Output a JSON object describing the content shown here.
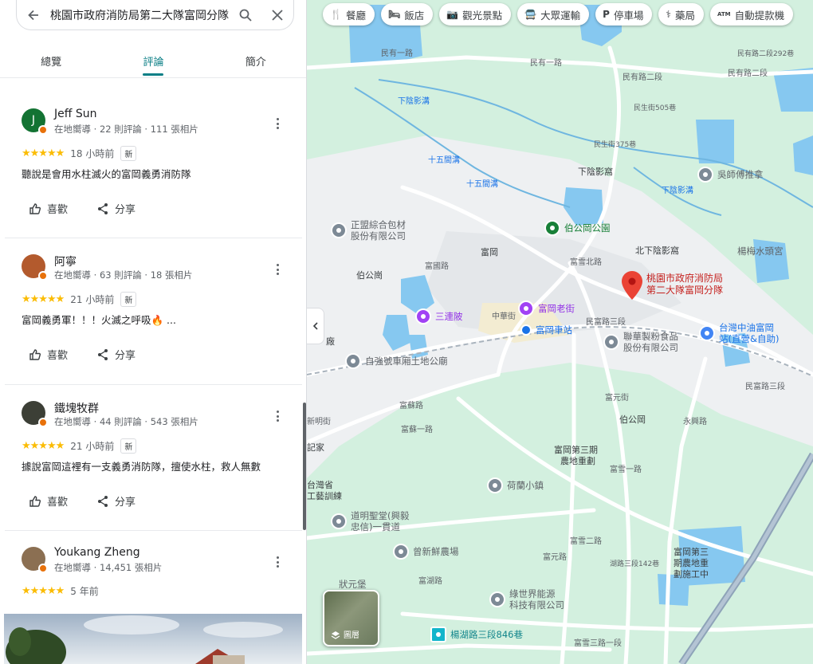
{
  "search": {
    "value": "桃園市政府消防局第二大隊富岡分隊",
    "back_icon": "arrow-left-icon",
    "search_icon": "search-icon",
    "close_icon": "close-icon"
  },
  "tabs": [
    {
      "label": "總覽",
      "active": false
    },
    {
      "label": "評論",
      "active": true
    },
    {
      "label": "簡介",
      "active": false
    }
  ],
  "reviews": [
    {
      "name": "Jeff Sun",
      "meta": "在地嚮導 · 22 則評論 · 111 張相片",
      "rating": "★★★★★",
      "time": "18 小時前",
      "badge": "新",
      "text": "聽說是會用水柱滅火的富岡義勇消防隊",
      "avatar_letter": "J",
      "avatar_color": "#137333",
      "like": "喜歡",
      "share": "分享"
    },
    {
      "name": "阿寧",
      "meta": "在地嚮導 · 63 則評論 · 18 張相片",
      "rating": "★★★★★",
      "time": "21 小時前",
      "badge": "新",
      "text": "富岡義勇軍！！！火滅之呼吸🔥 ...",
      "avatar_letter": "",
      "avatar_color": "#b35a2d",
      "like": "喜歡",
      "share": "分享"
    },
    {
      "name": "鐵塊牧群",
      "meta": "在地嚮導 · 44 則評論 · 543 張相片",
      "rating": "★★★★★",
      "time": "21 小時前",
      "badge": "新",
      "text": "據說富岡這裡有一支義勇消防隊，擅使水柱，救人無數",
      "avatar_letter": "",
      "avatar_color": "#3c3f36",
      "like": "喜歡",
      "share": "分享"
    },
    {
      "name": "Youkang Zheng",
      "meta": "在地嚮導 · 14,451 張相片",
      "rating": "★★★★★",
      "time": "5 年前",
      "badge": "",
      "text": "",
      "avatar_letter": "",
      "avatar_color": "#8b6f52",
      "like": "",
      "share": ""
    }
  ],
  "chips": [
    {
      "icon": "restaurant-icon",
      "glyph": "🍴",
      "label": "餐廳"
    },
    {
      "icon": "hotel-icon",
      "glyph": "🛏",
      "label": "飯店"
    },
    {
      "icon": "camera-icon",
      "glyph": "📷",
      "label": "觀光景點"
    },
    {
      "icon": "transit-icon",
      "glyph": "🚍",
      "label": "大眾運輸"
    },
    {
      "icon": "parking-icon",
      "glyph": "P",
      "label": "停車場"
    },
    {
      "icon": "pharmacy-icon",
      "glyph": "⚕",
      "label": "藥局"
    },
    {
      "icon": "atm-icon",
      "glyph": "ATM",
      "label": "自動提款機"
    }
  ],
  "layer_button": {
    "label": "圖層",
    "icon": "layers-icon"
  },
  "main_place": {
    "line1": "桃園市政府消防局",
    "line2": "第二大隊富岡分隊",
    "color": "#ea4335"
  },
  "map_labels": {
    "minyou1": "民有一路",
    "minyou1b": "民有一路",
    "minyou2a": "民有路二段",
    "minyou2b": "民有路二段",
    "minyou2c": "民有路二段292巷",
    "minsheng505": "民生街505巷",
    "minsheng375": "民生街375巷",
    "xiayin1": "下陰影溝",
    "xiayin2": "下陰影溝",
    "shiwu1": "十五間溝",
    "shiwu2": "十五間溝",
    "xiayinying": "下陰影窩",
    "beixiayinying": "北下陰影窩",
    "fugang": "富岡",
    "bogongang": "伯公崗",
    "bogongang2": "伯公岡",
    "fuxuebei": "富雪北路",
    "zhonghua": "中華街",
    "fuguo": "富國路",
    "mingfu3a": "民富路三段",
    "mingfu3b": "民富路三段",
    "fusu": "富蘇路",
    "fusu1": "富蘇一路",
    "fuyuan": "富元街",
    "fuyuan2": "富元路",
    "fuxue1": "富雪一路",
    "fuxue2": "富雪二路",
    "fuxue3": "富雪三路一段",
    "yongxing": "永興路",
    "fugang3": "富岡第三期",
    "fugang3b": "農地重劃",
    "fugang3c1": "富岡第三",
    "fugang3c2": "期農地重",
    "fugang3c3": "劃施工中",
    "hu3": "湖路三段142巷",
    "fuhu": "富湖路",
    "xin": "新明街",
    "ji": "記家",
    "tai1": "台灣省",
    "tai2": "工藝訓練",
    "fen": "份",
    "fen2": "廠"
  },
  "pois": {
    "zhengmeng1": "正盟綜合包材",
    "zhengmeng2": "股份有限公司",
    "bogongpark": "伯公岡公園",
    "wushi": "吳師傅推拿",
    "yangmei": "楊梅水頭宮",
    "sanlianpi": "三連陂",
    "oldstreet": "富岡老街",
    "station": "富岡車站",
    "lianhua1": "聯華製粉食品",
    "lianhua2": "股份有限公司",
    "cpc1": "台灣中油富岡",
    "cpc2": "站(直營&自助)",
    "zhuqiang": "自強號車廂土地公廟",
    "helan": "荷蘭小鎮",
    "daoming1": "道明聖堂(興毅",
    "daoming2": "忠信)一貫道",
    "zengxin": "曾新鮮農場",
    "zhuangyuan": "狀元堡",
    "lvshijie1": "綠世界能源",
    "lvshijie2": "科技有限公司",
    "yanghu": "楊湖路三段846巷"
  }
}
